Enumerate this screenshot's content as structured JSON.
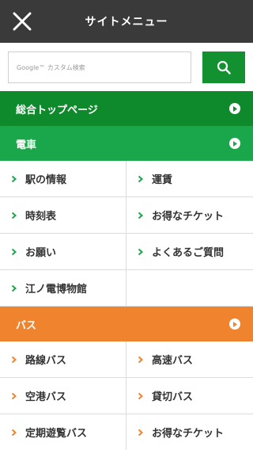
{
  "header": {
    "title": "サイトメニュー",
    "close_icon": "close-icon"
  },
  "search": {
    "placeholder": "Google™ カスタム検索",
    "button_icon": "search-icon"
  },
  "colors": {
    "dark": "#3a3a3a",
    "green_dark": "#0e8a2c",
    "green": "#1aa64a",
    "orange": "#f0832e"
  },
  "sections": {
    "top": {
      "label": "総合トップページ"
    },
    "train": {
      "label": "電車",
      "items": [
        "駅の情報",
        "運賃",
        "時刻表",
        "お得なチケット",
        "お願い",
        "よくあるご質問",
        "江ノ電博物館"
      ]
    },
    "bus": {
      "label": "バス",
      "items": [
        "路線バス",
        "高速バス",
        "空港バス",
        "貸切バス",
        "定期遊覧バス",
        "お得なチケット"
      ]
    }
  }
}
